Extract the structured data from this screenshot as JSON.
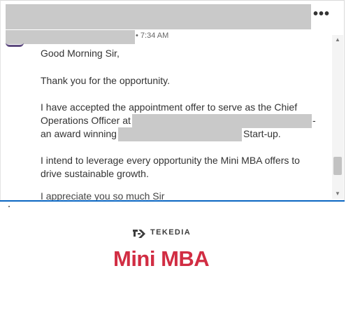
{
  "message": {
    "timestamp": "• 7:34 AM",
    "lines": [
      "Good Morning Sir,",
      "Thank you for the opportunity.",
      "I have accepted the appointment offer to serve as the Chief",
      "Operations Officer at",
      "-",
      "an award winning",
      "Start-up.",
      "I intend to leverage every opportunity the Mini MBA offers to",
      "drive sustainable growth.",
      "I appreciate you so much Sir"
    ]
  },
  "toolbar": {
    "more_label": "•••"
  },
  "brand": {
    "company_name": "TEKEDIA",
    "program_name": "Mini MBA",
    "colors": {
      "accent": "#d12d43",
      "logo": "#3d3d3d",
      "link": "#0a66c2"
    }
  },
  "icons": {
    "more": "ellipsis-icon",
    "scroll_up": "chevron-up-icon",
    "scroll_down": "chevron-down-icon",
    "logo": "tekedia-logo-icon"
  }
}
